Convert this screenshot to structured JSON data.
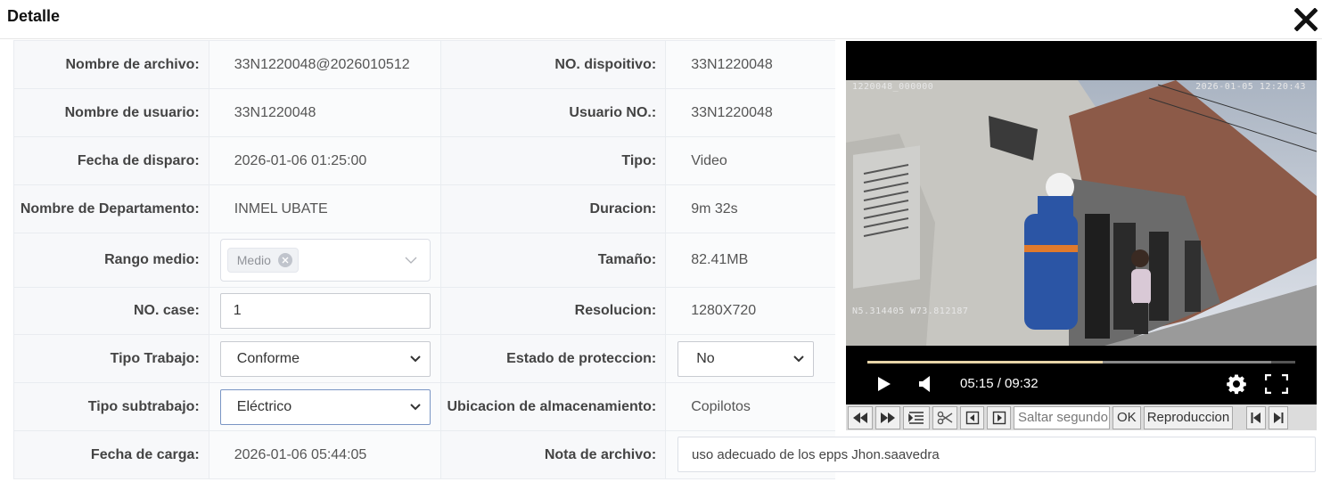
{
  "dialog": {
    "title": "Detalle"
  },
  "rows": [
    {
      "label1": "Nombre de archivo:",
      "value1": "33N1220048@2026010512",
      "label2": "NO. dispoitivo:",
      "value2": "33N1220048"
    },
    {
      "label1": "Nombre de usuario:",
      "value1": "33N1220048",
      "label2": "Usuario NO.:",
      "value2": "33N1220048"
    },
    {
      "label1": "Fecha de disparo:",
      "value1": "2026-01-06 01:25:00",
      "label2": "Tipo:",
      "value2": "Video"
    },
    {
      "label1": "Nombre de Departamento:",
      "value1": "INMEL UBATE",
      "label2": "Duracion:",
      "value2": "9m 32s"
    },
    {
      "label1": "Rango medio:",
      "label2": "Tamaño:",
      "value2": "82.41MB"
    },
    {
      "label1": "NO. case:",
      "label2": "Resolucion:",
      "value2": "1280X720"
    },
    {
      "label1": "Tipo Trabajo:",
      "label2": "Estado de proteccion:"
    },
    {
      "label1": "Tipo subtrabajo:",
      "label2": "Ubicacion de almacenamiento:",
      "value2": "Copilotos"
    },
    {
      "label1": "Fecha de carga:",
      "value1": "2026-01-06 05:44:05",
      "label2": "Nota de archivo:"
    }
  ],
  "form": {
    "rango_medio_tag": "Medio",
    "case_no": "1",
    "tipo_trabajo": "Conforme",
    "estado_proteccion": "No",
    "tipo_subtrabajo": "Eléctrico",
    "nota_archivo": "uso adecuado de los epps Jhon.saavedra"
  },
  "player": {
    "osd_top_left": "1220048_000000",
    "osd_top_right": "2026-01-05  12:20:43",
    "osd_bottom_left": "N5.314405  W73.812187",
    "time_display": "05:15 / 09:32",
    "progress_fraction": 0.551,
    "buffered_fraction": 0.944
  },
  "toolbar": {
    "seek_placeholder": "Saltar segundo",
    "ok_label": "OK",
    "playback_label": "Reproduccion"
  },
  "colors": {
    "label_bg": "#f7f8fa",
    "border": "#e9ecf0",
    "progress": "#e8d5a8"
  }
}
